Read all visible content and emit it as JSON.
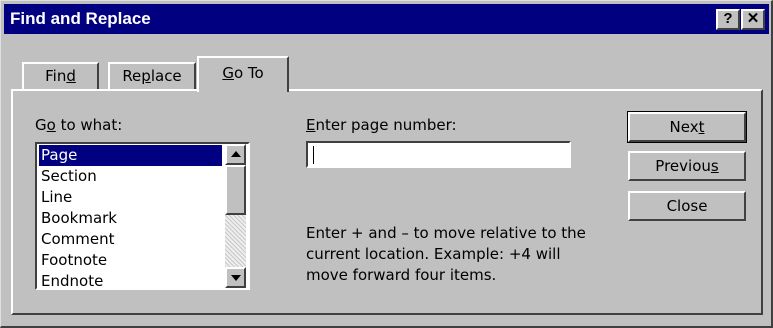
{
  "window": {
    "title": "Find and Replace",
    "help_glyph": "?",
    "close_glyph": "✕"
  },
  "tabs": [
    {
      "label_pre": "Fin",
      "label_acc": "d",
      "label_post": "",
      "active": false
    },
    {
      "label_pre": "Re",
      "label_acc": "p",
      "label_post": "lace",
      "active": false
    },
    {
      "label_pre": "",
      "label_acc": "G",
      "label_post": "o To",
      "active": true
    }
  ],
  "goto": {
    "label_pre": "G",
    "label_acc": "o",
    "label_post": " to what:",
    "items": [
      "Page",
      "Section",
      "Line",
      "Bookmark",
      "Comment",
      "Footnote",
      "Endnote"
    ],
    "selected": "Page"
  },
  "page_number": {
    "label_pre": "",
    "label_acc": "E",
    "label_post": "nter page number:",
    "value": ""
  },
  "help_text": "Enter + and – to move relative to the current location. Example: +4 will move forward four items.",
  "buttons": {
    "next": {
      "pre": "Nex",
      "acc": "t",
      "post": ""
    },
    "previous": {
      "pre": "Previou",
      "acc": "s",
      "post": ""
    },
    "close": {
      "pre": "Close",
      "acc": "",
      "post": ""
    }
  },
  "colors": {
    "titlebar": "#000080",
    "face": "#c0c0c0",
    "selection": "#000080"
  }
}
